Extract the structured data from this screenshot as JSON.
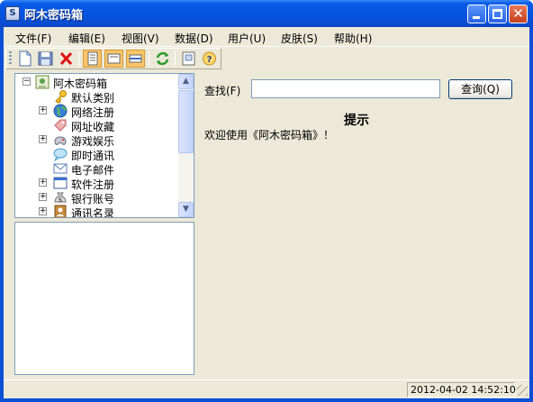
{
  "window": {
    "title": "阿木密码箱",
    "app_icon_glyph": "S"
  },
  "menu": [
    {
      "label": "文件(F)"
    },
    {
      "label": "编辑(E)"
    },
    {
      "label": "视图(V)"
    },
    {
      "label": "数据(D)"
    },
    {
      "label": "用户(U)"
    },
    {
      "label": "皮肤(S)"
    },
    {
      "label": "帮助(H)"
    }
  ],
  "toolbar": {
    "tools": [
      "new-icon",
      "save-icon",
      "delete-icon",
      "view-list-icon",
      "view-detail-icon",
      "view-split-icon",
      "refresh-icon",
      "about-icon",
      "help-icon"
    ]
  },
  "tree": {
    "root": "阿木密码箱",
    "items": [
      {
        "label": "默认类别",
        "icon": "key-icon",
        "expandable": false
      },
      {
        "label": "网络注册",
        "icon": "globe-icon",
        "expandable": true
      },
      {
        "label": "网址收藏",
        "icon": "tag-icon",
        "expandable": false
      },
      {
        "label": "游戏娱乐",
        "icon": "gamepad-icon",
        "expandable": true
      },
      {
        "label": "即时通讯",
        "icon": "chat-bubble-icon",
        "expandable": false
      },
      {
        "label": "电子邮件",
        "icon": "envelope-icon",
        "expandable": false
      },
      {
        "label": "软件注册",
        "icon": "window-icon",
        "expandable": true
      },
      {
        "label": "银行账号",
        "icon": "money-bag-icon",
        "expandable": true
      },
      {
        "label": "通讯名录",
        "icon": "contacts-icon",
        "expandable": true
      }
    ]
  },
  "search": {
    "label": "查找(F)",
    "value": "",
    "button": "查询(Q)"
  },
  "tip": {
    "title": "提示",
    "welcome": "欢迎使用《阿木密码箱》！"
  },
  "status": {
    "datetime": "2012-04-02 14:52:10"
  },
  "colors": {
    "titlebar": "#0553e0",
    "face": "#ece9d8",
    "border": "#7f9db9",
    "highlight": "#f9c56b"
  }
}
